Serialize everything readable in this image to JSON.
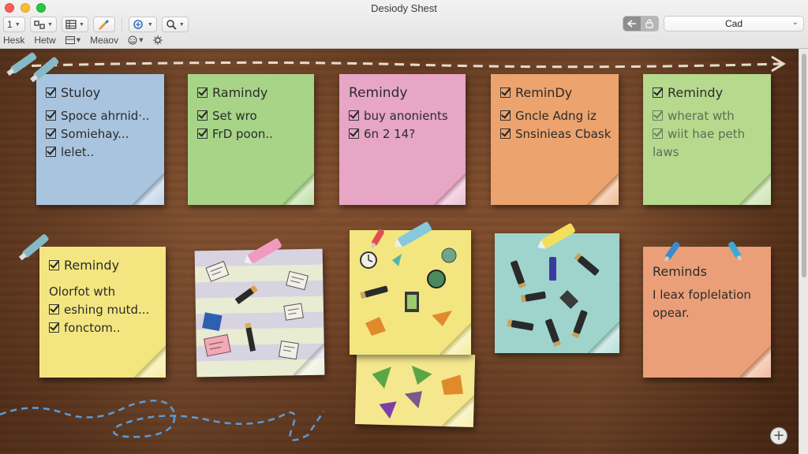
{
  "window": {
    "title": "Desiody Shest"
  },
  "toolbar": {
    "font_size": "1",
    "row_labels": [
      "Hesk",
      "Hetw",
      "Meaov"
    ]
  },
  "view_select": {
    "value": "Cad"
  },
  "notes": [
    {
      "title": "Stuloy",
      "lines": [
        "Spoce ahrnid·..",
        "Somiehay...",
        "lelet.."
      ]
    },
    {
      "title": "Ramindy",
      "lines": [
        "Set wro",
        "FrD poon.."
      ]
    },
    {
      "title": "Remindy",
      "lines": [
        "buy anonients",
        "6n 2 14?"
      ]
    },
    {
      "title": "ReminDy",
      "lines": [
        "Gncle Adng iz",
        "Snsinieas Cbask"
      ]
    },
    {
      "title": "Remindy",
      "lines": [
        "wherat wth",
        "wiit hae peth",
        "laws"
      ]
    },
    {
      "title": "Remindy",
      "lines": [
        "Olorfot wth",
        "eshing mutd...",
        "fonctom.."
      ]
    },
    {
      "title": "Reminds",
      "lines": [
        "I leax foplelation",
        "opear."
      ]
    }
  ],
  "icons": {
    "checkbox": "checkbox-checked-icon",
    "pin": "pushpin-icon",
    "add": "plus-icon"
  },
  "colors": {
    "note_blue": "#a9c4de",
    "note_green": "#a7d487",
    "note_pink": "#e7a6c6",
    "note_orange": "#eca36e",
    "note_lime": "#b6d98d",
    "note_yellow": "#f3e681",
    "note_teal": "#9fd4cc",
    "note_salmon": "#ea9f78",
    "board_wood": "#7a4524"
  }
}
